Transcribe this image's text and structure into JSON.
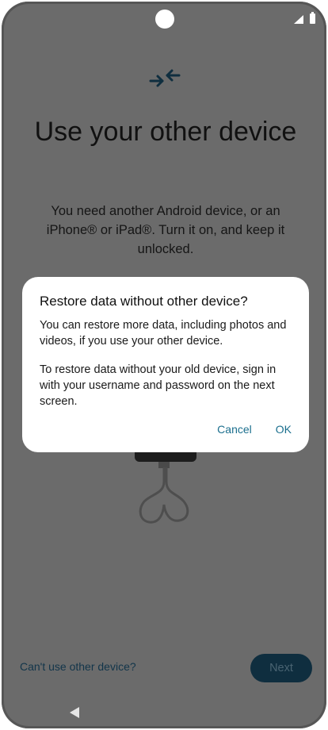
{
  "page": {
    "title": "Use your other device",
    "description": "You need another Android device, or an iPhone® or iPad®. Turn it on, and keep it unlocked.",
    "cant_use_link": "Can't use other device?",
    "next_label": "Next"
  },
  "dialog": {
    "title": "Restore data without other device?",
    "paragraph_1": "You can restore more data, including photos and videos, if you use your other device.",
    "paragraph_2": "To restore data without your old device, sign in with your username and password on the next screen.",
    "cancel_label": "Cancel",
    "ok_label": "OK"
  },
  "icons": {
    "header": "connect-arrows-icon",
    "illustration": "phone-with-cable-illustration",
    "nav_back": "back-triangle-icon"
  },
  "colors": {
    "scrim": "#6b6b6b",
    "icon_accent": "#0f2e3f",
    "dialog_button_text": "#1b6f8e",
    "next_button_bg": "#0f2e3f"
  }
}
